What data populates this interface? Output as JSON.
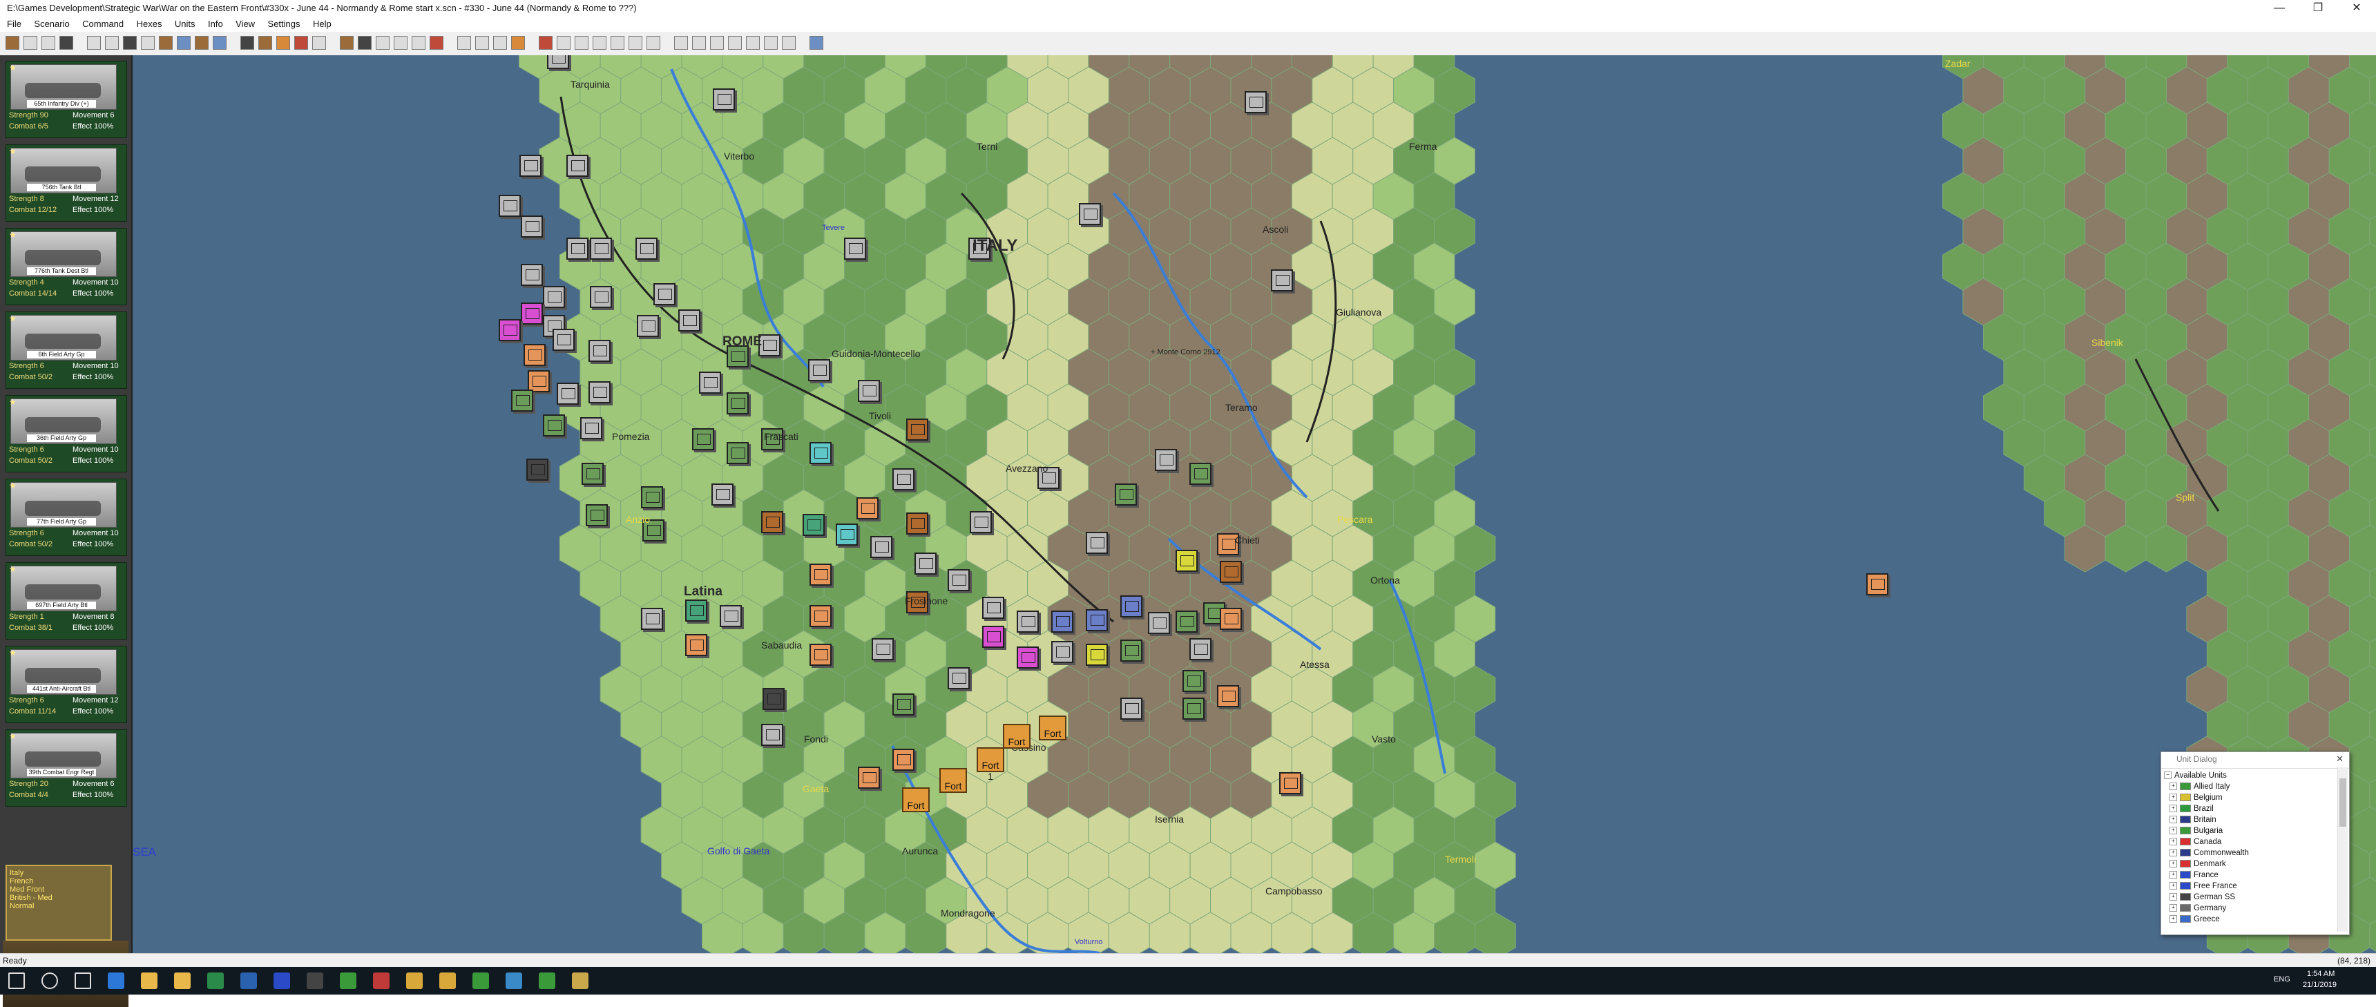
{
  "window": {
    "title": "E:\\Games Development\\Strategic War\\War on the Eastern Front\\#330x - June 44 - Normandy & Rome start x.scn - #330 - June 44 (Normandy & Rome to ???)",
    "min": "—",
    "max": "❐",
    "close": "✕"
  },
  "menu": [
    "File",
    "Scenario",
    "Command",
    "Hexes",
    "Units",
    "Info",
    "View",
    "Settings",
    "Help"
  ],
  "left_panel": {
    "cards": [
      {
        "name": "65th Infantry Div (+)",
        "s1": "Strength 90",
        "s2": "Movement 6",
        "s3": "Combat 6/5",
        "s4": "Effect 100%"
      },
      {
        "name": "756th Tank Btl",
        "s1": "Strength 8",
        "s2": "Movement 12",
        "s3": "Combat 12/12",
        "s4": "Effect 100%"
      },
      {
        "name": "776th Tank Dest Btl",
        "s1": "Strength 4",
        "s2": "Movement 10",
        "s3": "Combat 14/14",
        "s4": "Effect 100%"
      },
      {
        "name": "6th Field Arty Gp",
        "s1": "Strength 6",
        "s2": "Movement 10",
        "s3": "Combat 50/2",
        "s4": "Effect 100%"
      },
      {
        "name": "36th Field Arty Gp",
        "s1": "Strength 6",
        "s2": "Movement 10",
        "s3": "Combat 50/2",
        "s4": "Effect 100%"
      },
      {
        "name": "77th Field Arty Gp",
        "s1": "Strength 6",
        "s2": "Movement 10",
        "s3": "Combat 50/2",
        "s4": "Effect 100%"
      },
      {
        "name": "697th Field Arty Btl",
        "s1": "Strength 1",
        "s2": "Movement 8",
        "s3": "Combat 38/1",
        "s4": "Effect 100%"
      },
      {
        "name": "441st Anti-Aircraft Btl",
        "s1": "Strength 6",
        "s2": "Movement 12",
        "s3": "Combat 11/14",
        "s4": "Effect 100%"
      },
      {
        "name": "39th Combat Engr Regt",
        "s1": "Strength 20",
        "s2": "Movement 6",
        "s3": "Combat 4/4",
        "s4": "Effect 100%"
      }
    ],
    "portrait_text": "Italy\nFrench\nMed Front\nBritish - Med\nNormal"
  },
  "map": {
    "labels": {
      "tarquinia": "Tarquinia",
      "viterbo": "Viterbo",
      "terni": "Terni",
      "fermo": "Ferma",
      "italy": "ITALY",
      "ascoli": "Ascoli",
      "giulianova": "Giulianova",
      "rome": "ROME",
      "guidonia": "Guidonia-Montecello",
      "monte_corno": "+ Monte Corno 2912",
      "teramo": "Teramo",
      "tivoli": "Tivoli",
      "pomezia": "Pomezia",
      "frascati": "Frascati",
      "avezzano": "Avezzano",
      "anzio": "Anzio",
      "chieti": "Chieti",
      "pescara": "Pescara",
      "ortona": "Ortona",
      "latina": "Latina",
      "frosinone": "Frosinone",
      "sabaudia": "Sabaudia",
      "atessa": "Atessa",
      "cassino": "Cassino",
      "fondi": "Fondi",
      "vasto": "Vasto",
      "gaeta": "Gaeta",
      "isernia": "Isernia",
      "golfo": "Golfo di Gaeta",
      "aurunca": "Aurunca",
      "termoli": "Termoli",
      "campobasso": "Campobasso",
      "mondragone": "Mondragone",
      "volturno": "Volturno",
      "sea": "SEA",
      "zadar": "Zadar",
      "sibenik": "Sibenik",
      "split": "Split",
      "tevere": "Tevere"
    },
    "forts": [
      "Fort",
      "Fort",
      "Fort 1",
      "Fort",
      "Fort"
    ],
    "colors": {
      "sea": "#4a6a8a",
      "plain": "#cfd69a",
      "hill": "#9ec77a",
      "green": "#6fa05a",
      "mountain": "#8a7c66",
      "river": "#3a7ed8"
    }
  },
  "unit_dialog": {
    "title": "Unit Dialog",
    "close": "✕",
    "root": "Available Units",
    "items": [
      {
        "label": "Allied Italy",
        "flag": "#3a9a3a"
      },
      {
        "label": "Belgium",
        "flag": "#d8c030"
      },
      {
        "label": "Brazil",
        "flag": "#2a9a3a"
      },
      {
        "label": "Britain",
        "flag": "#2a3a8a"
      },
      {
        "label": "Bulgaria",
        "flag": "#3a9a3a"
      },
      {
        "label": "Canada",
        "flag": "#d83030"
      },
      {
        "label": "Commonwealth",
        "flag": "#2a3a8a"
      },
      {
        "label": "Denmark",
        "flag": "#d83030"
      },
      {
        "label": "France",
        "flag": "#2a4ac8"
      },
      {
        "label": "Free France",
        "flag": "#2a4ac8"
      },
      {
        "label": "German SS",
        "flag": "#444444"
      },
      {
        "label": "Germany",
        "flag": "#6a6a6a"
      },
      {
        "label": "Greece",
        "flag": "#3a6ac8"
      }
    ]
  },
  "status": {
    "left": "Ready",
    "right": "(84, 218)"
  },
  "taskbar": {
    "lang": "ENG",
    "time": "1:54 AM",
    "date": "21/1/2019"
  }
}
